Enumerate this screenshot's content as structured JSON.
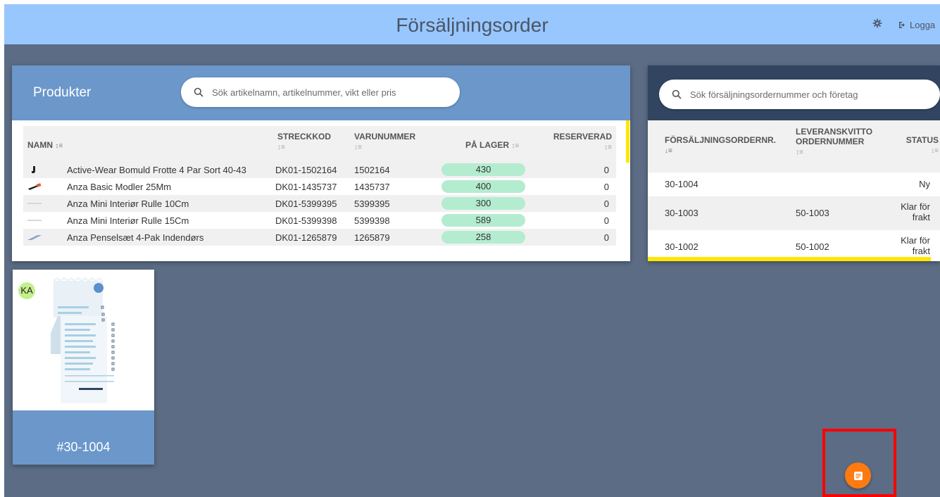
{
  "header": {
    "title": "Försäljningsorder",
    "logout_label": "Logga"
  },
  "products": {
    "title": "Produkter",
    "search_placeholder": "Sök artikelnamn, artikelnummer, vikt eller pris",
    "columns": {
      "name": "NAMN",
      "barcode": "STRECKKOD",
      "item_no": "VARUNUMMER",
      "stock": "PÅ LAGER",
      "reserved": "RESERVERAD"
    },
    "rows": [
      {
        "name": "Active-Wear Bomuld Frotte 4 Par Sort 40-43",
        "barcode": "DK01-1502164",
        "item_no": "1502164",
        "stock": "430",
        "reserved": "0"
      },
      {
        "name": "Anza Basic Modler 25Mm",
        "barcode": "DK01-1435737",
        "item_no": "1435737",
        "stock": "400",
        "reserved": "0"
      },
      {
        "name": "Anza Mini Interiør Rulle 10Cm",
        "barcode": "DK01-5399395",
        "item_no": "5399395",
        "stock": "300",
        "reserved": "0"
      },
      {
        "name": "Anza Mini Interiør Rulle 15Cm",
        "barcode": "DK01-5399398",
        "item_no": "5399398",
        "stock": "589",
        "reserved": "0"
      },
      {
        "name": "Anza Penselsæt 4-Pak Indendørs",
        "barcode": "DK01-1265879",
        "item_no": "1265879",
        "stock": "258",
        "reserved": "0"
      }
    ]
  },
  "orders": {
    "search_placeholder": "Sök försäljningsordernummer och företag",
    "columns": {
      "order_no": "FÖRSÄLJNINGSORDERNR.",
      "delivery_line1": "LEVERANSKVITTO",
      "delivery_line2": "ORDERNUMMER",
      "status": "STATUS"
    },
    "rows": [
      {
        "order_no": "30-1004",
        "delivery": "",
        "status_line1": "Ny",
        "status_line2": ""
      },
      {
        "order_no": "30-1003",
        "delivery": "50-1003",
        "status_line1": "Klar för",
        "status_line2": "frakt"
      },
      {
        "order_no": "30-1002",
        "delivery": "50-1002",
        "status_line1": "Klar för",
        "status_line2": "frakt"
      }
    ]
  },
  "card": {
    "avatar": "KA",
    "order_number": "#30-1004"
  },
  "colors": {
    "header": "#98c7fd",
    "background": "#5b6c84",
    "accent": "#6b97cb",
    "orders_header": "#314560",
    "stock_pill": "#b4ecd0",
    "highlight": "#ffe600",
    "fab": "#ff7a11",
    "avatar": "#c4f08c"
  },
  "icons": {
    "settings": "gear-icon",
    "logout": "logout-icon",
    "search": "search-icon",
    "sort": "sort-icon",
    "fab": "note-icon"
  }
}
